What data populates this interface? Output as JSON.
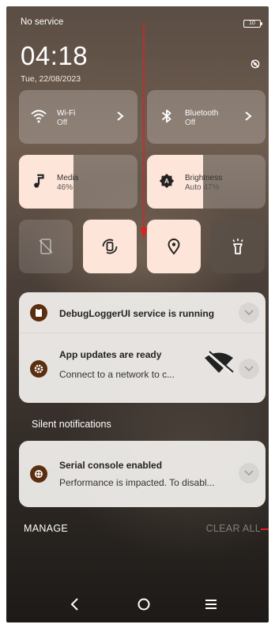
{
  "status": {
    "carrier": "No service",
    "battery": "10"
  },
  "header": {
    "time": "04:18",
    "date": "Tue, 22/08/2023"
  },
  "tiles": {
    "wifi": {
      "title": "Wi-Fi",
      "state": "Off"
    },
    "bluetooth": {
      "title": "Bluetooth",
      "state": "Off"
    },
    "media": {
      "title": "Media",
      "value": "46%",
      "level": 0.46
    },
    "brightness": {
      "title": "Brightness",
      "value": "Auto 47%",
      "level": 0.47
    }
  },
  "notifications": [
    {
      "title": "DebugLoggerUI service is running",
      "body": ""
    },
    {
      "title": "App updates are ready",
      "body": "Connect to a network to c..."
    }
  ],
  "silent": {
    "label": "Silent notifications",
    "items": [
      {
        "title": "Serial console enabled",
        "body": "Performance is impacted. To disabl..."
      }
    ]
  },
  "footer": {
    "manage": "MANAGE",
    "clear_all": "CLEAR ALL"
  },
  "colors": {
    "accent_tile": "#fde6d9",
    "app_icon": "#5a2e0f",
    "annotation": "#e02020"
  }
}
